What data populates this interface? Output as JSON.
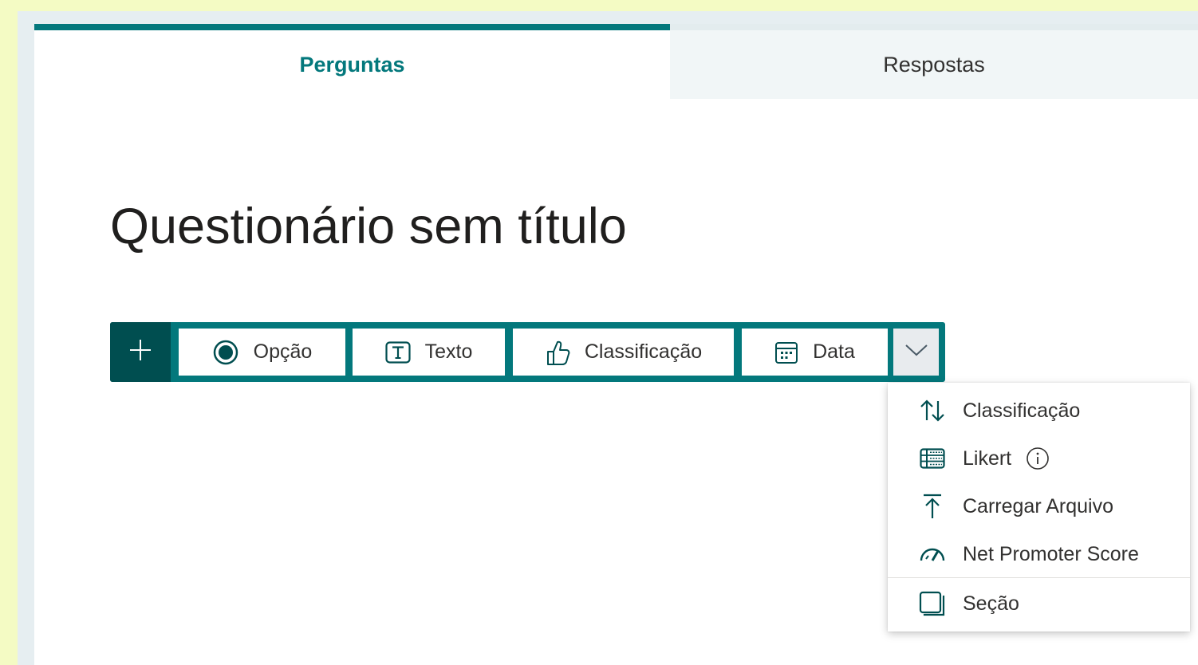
{
  "tabs": [
    {
      "label": "Perguntas",
      "active": true
    },
    {
      "label": "Respostas",
      "active": false
    }
  ],
  "form": {
    "title": "Questionário sem título"
  },
  "toolbar": {
    "buttons": [
      {
        "label": "Opção",
        "icon": "radio-option-icon"
      },
      {
        "label": "Texto",
        "icon": "text-box-icon"
      },
      {
        "label": "Classificação",
        "icon": "thumbs-up-icon"
      },
      {
        "label": "Data",
        "icon": "calendar-icon"
      }
    ],
    "add_icon": "plus-icon",
    "more_icon": "chevron-down-icon"
  },
  "dropdown": {
    "items": [
      {
        "label": "Classificação",
        "icon": "sort-arrows-icon"
      },
      {
        "label": "Likert",
        "icon": "likert-grid-icon",
        "has_info": true
      },
      {
        "label": "Carregar Arquivo",
        "icon": "upload-icon"
      },
      {
        "label": "Net Promoter Score",
        "icon": "gauge-icon"
      },
      {
        "label": "Seção",
        "icon": "section-icon"
      }
    ]
  },
  "colors": {
    "accent": "#03787c",
    "accent_dark": "#004e50",
    "page_background": "#f4fbc4",
    "frame_background": "#e6eef1"
  }
}
